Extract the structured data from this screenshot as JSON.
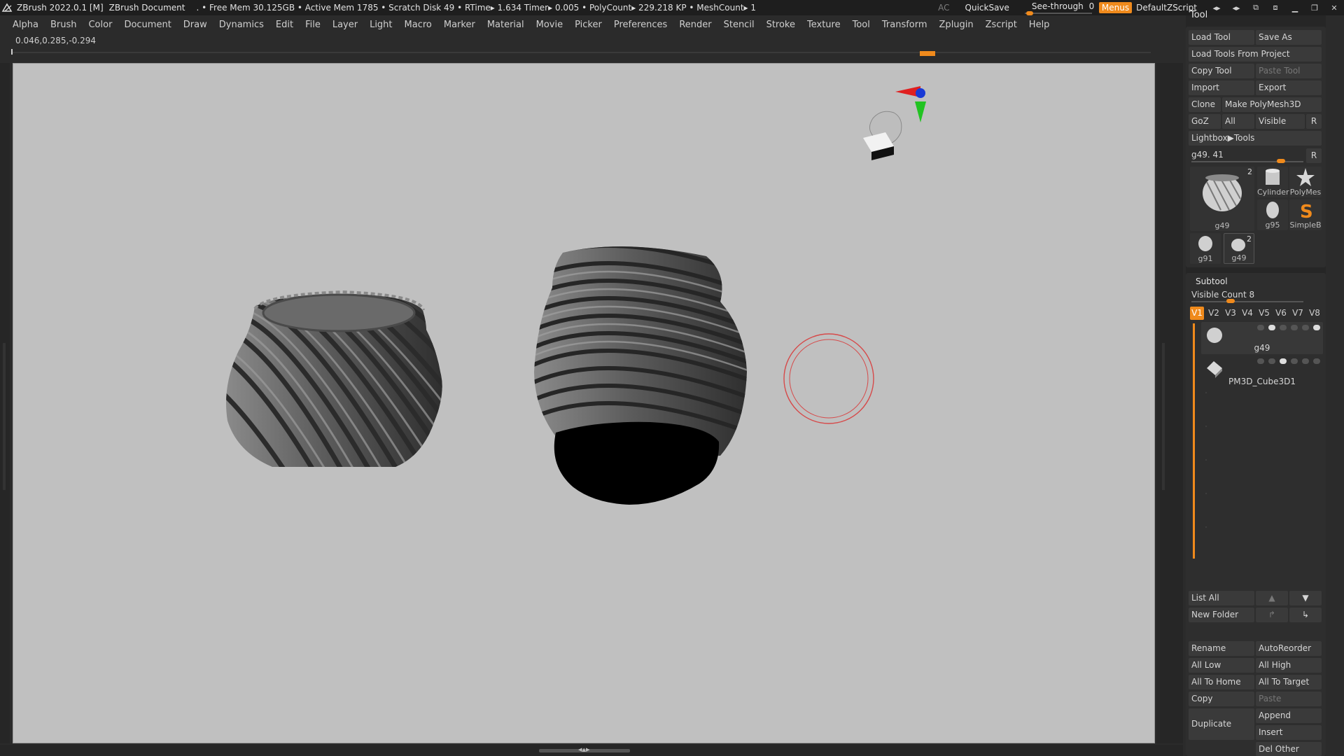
{
  "titlebar": {
    "app": "ZBrush 2022.0.1 [M]",
    "document": "ZBrush Document",
    "stats": ". • Free Mem 30.125GB • Active Mem 1785 • Scratch Disk 49 •  RTime▸ 1.634 Timer▸ 0.005 • PolyCount▸ 229.218 KP  • MeshCount▸ 1",
    "ac": "AC",
    "quicksave": "QuickSave",
    "see_through_label": "See-through",
    "see_through_value": "0",
    "menus": "Menus",
    "script": "DefaultZScript"
  },
  "menubar": [
    "Alpha",
    "Brush",
    "Color",
    "Document",
    "Draw",
    "Dynamics",
    "Edit",
    "File",
    "Layer",
    "Light",
    "Macro",
    "Marker",
    "Material",
    "Movie",
    "Picker",
    "Preferences",
    "Render",
    "Stencil",
    "Stroke",
    "Texture",
    "Tool",
    "Transform",
    "Zplugin",
    "Zscript",
    "Help"
  ],
  "coordinates": "0.046,0.285,-0.294",
  "tool_palette": {
    "title": "Tool",
    "load_tool": "Load Tool",
    "save_as": "Save As",
    "load_from_project": "Load Tools From Project",
    "copy_tool": "Copy Tool",
    "paste_tool": "Paste Tool",
    "import": "Import",
    "export": "Export",
    "clone": "Clone",
    "make_polymesh": "Make PolyMesh3D",
    "goz": "GoZ",
    "all": "All",
    "visible": "Visible",
    "r": "R",
    "lightbox": "Lightbox▶Tools",
    "tool_slider_label": "g49.",
    "tool_slider_value": "41",
    "tool_slider_fraction": 0.8,
    "thumbs": [
      {
        "label": "g49",
        "count": "2"
      },
      {
        "label": "Cylinder"
      },
      {
        "label": "PolyMes"
      },
      {
        "label": "g95"
      },
      {
        "label": "SimpleB"
      },
      {
        "label": "g91"
      },
      {
        "label": "g49",
        "count": "2"
      }
    ]
  },
  "subtool": {
    "title": "Subtool",
    "visible_count_label": "Visible Count",
    "visible_count_value": "8",
    "tabs": [
      "V1",
      "V2",
      "V3",
      "V4",
      "V5",
      "V6",
      "V7",
      "V8"
    ],
    "active_tab": "V1",
    "items": [
      {
        "name": "g49",
        "selected": true
      },
      {
        "name": "PM3D_Cube3D1",
        "selected": false
      }
    ],
    "list_all": "List All",
    "new_folder": "New Folder",
    "rename": "Rename",
    "autoreorder": "AutoReorder",
    "all_low": "All Low",
    "all_high": "All High",
    "all_to_home": "All To Home",
    "all_to_target": "All To Target",
    "copy": "Copy",
    "paste": "Paste",
    "duplicate": "Duplicate",
    "append": "Append",
    "insert": "Insert",
    "del_other": "Del Other"
  },
  "colors": {
    "accent": "#f08a1c",
    "canvas_bg": "#c0c0c0",
    "ui_bg": "#262626",
    "button_bg": "#3a3a3a"
  }
}
